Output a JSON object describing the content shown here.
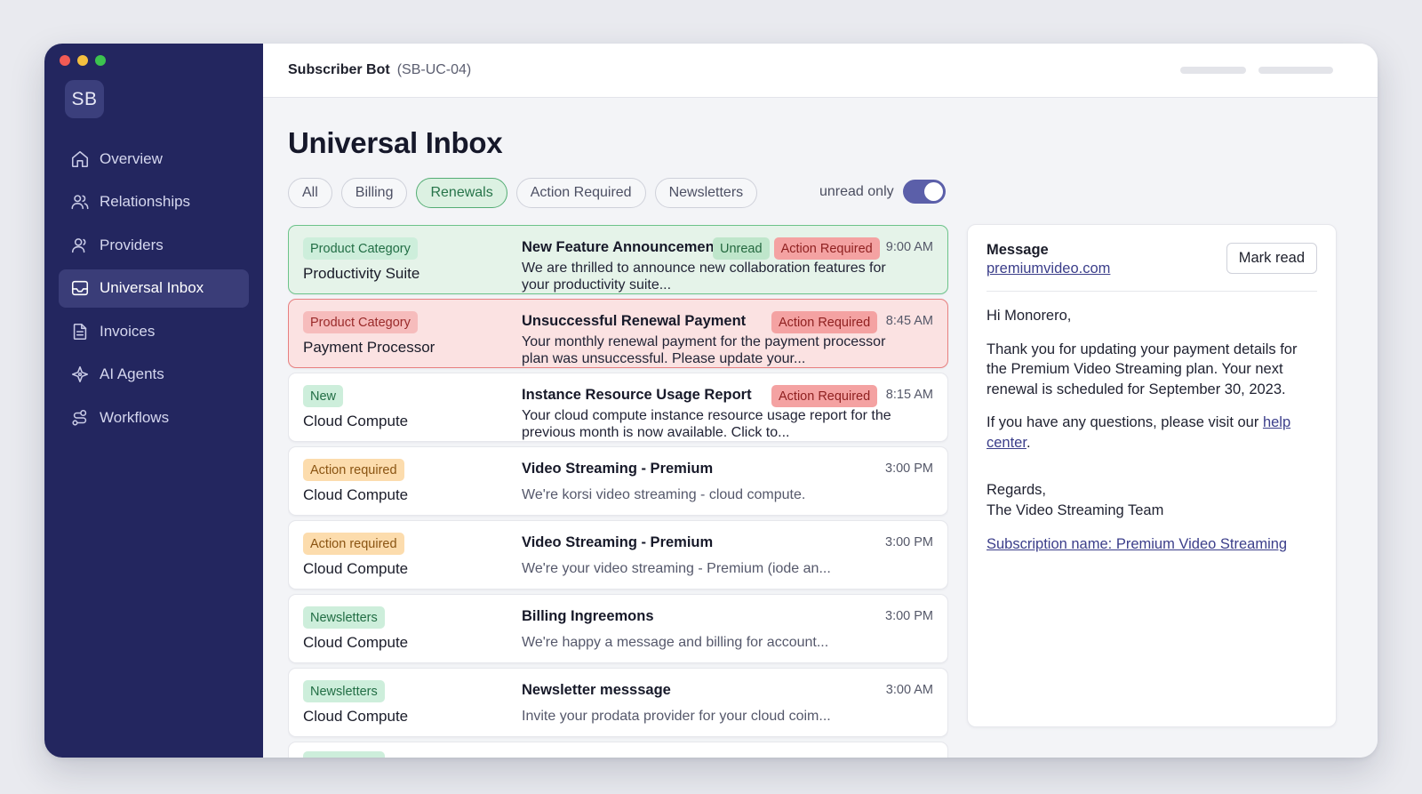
{
  "window": {
    "logo": "SB"
  },
  "sidebar": {
    "items": [
      {
        "label": "Overview",
        "icon": "home-icon"
      },
      {
        "label": "Relationships",
        "icon": "users-icon"
      },
      {
        "label": "Providers",
        "icon": "user-icon"
      },
      {
        "label": "Universal Inbox",
        "icon": "inbox-icon",
        "active": true
      },
      {
        "label": "Invoices",
        "icon": "document-icon"
      },
      {
        "label": "AI Agents",
        "icon": "sparkle-icon"
      },
      {
        "label": "Workflows",
        "icon": "workflow-icon"
      }
    ]
  },
  "header": {
    "bot_name": "Subscriber Bot",
    "bot_id": "(SB-UC-04)"
  },
  "page": {
    "title": "Universal Inbox"
  },
  "filters": {
    "chips": [
      "All",
      "Billing",
      "Renewals",
      "Action Required",
      "Newsletters"
    ],
    "active": "Renewals",
    "unread_label": "unread only",
    "unread_only": true
  },
  "inbox": {
    "rows": [
      {
        "badge": "Product Category",
        "provider": "Productivity Suite",
        "subject": "New Feature Announcement",
        "tags": [
          "Unread",
          "Action Required"
        ],
        "time": "9:00 AM",
        "preview": "We are thrilled to announce new collaboration features for your productivity suite..."
      },
      {
        "badge": "Product Category",
        "provider": "Payment Processor",
        "subject": "Unsuccessful Renewal Payment",
        "tags": [
          "Action Required"
        ],
        "time": "8:45 AM",
        "preview": "Your monthly renewal payment for the payment processor plan was unsuccessful. Please update your..."
      },
      {
        "badge": "New",
        "provider": "Cloud Compute",
        "subject": "Instance Resource Usage Report",
        "tags": [
          "Action Required"
        ],
        "time": "8:15 AM",
        "preview": "Your cloud compute instance resource usage report for the previous month is now available. Click to..."
      },
      {
        "badge": "Action required",
        "provider": "Cloud Compute",
        "subject": "Video Streaming - Premium",
        "tags": [],
        "time": "3:00 PM",
        "preview": "We're korsi video streaming - cloud compute."
      },
      {
        "badge": "Action required",
        "provider": "Cloud Compute",
        "subject": "Video Streaming - Premium",
        "tags": [],
        "time": "3:00 PM",
        "preview": "We're your video streaming - Premium (iode an..."
      },
      {
        "badge": "Newsletters",
        "provider": "Cloud Compute",
        "subject": "Billing Ingreemons",
        "tags": [],
        "time": "3:00 PM",
        "preview": "We're happy a message and  billing for account..."
      },
      {
        "badge": "Newsletters",
        "provider": "Cloud Compute",
        "subject": "Newsletter messsage",
        "tags": [],
        "time": "3:00 AM",
        "preview": "Invite your prodata provider for your cloud coim..."
      }
    ]
  },
  "detail": {
    "label": "Message",
    "sender": "premiumvideo.com",
    "mark_read": "Mark read",
    "greeting": "Hi Monorero,",
    "paragraph1": "Thank you for updating your payment details for the Premium Video Streaming plan. Your next renewal is scheduled for September 30, 2023.",
    "paragraph2_prefix": "If you have any questions, please visit our ",
    "paragraph2_link": "help center",
    "paragraph2_suffix": ".",
    "regards": "Regards,",
    "signature": "The Video Streaming Team",
    "subscription_link": "Subscription name: Premium Video Streaming"
  },
  "colors": {
    "sidebar_bg": "#23265f",
    "active_chip": "#54ad74",
    "toggle_on": "#5b5fa9",
    "highlight_green": "#e5f3e9",
    "highlight_red": "#fbe2e2"
  }
}
